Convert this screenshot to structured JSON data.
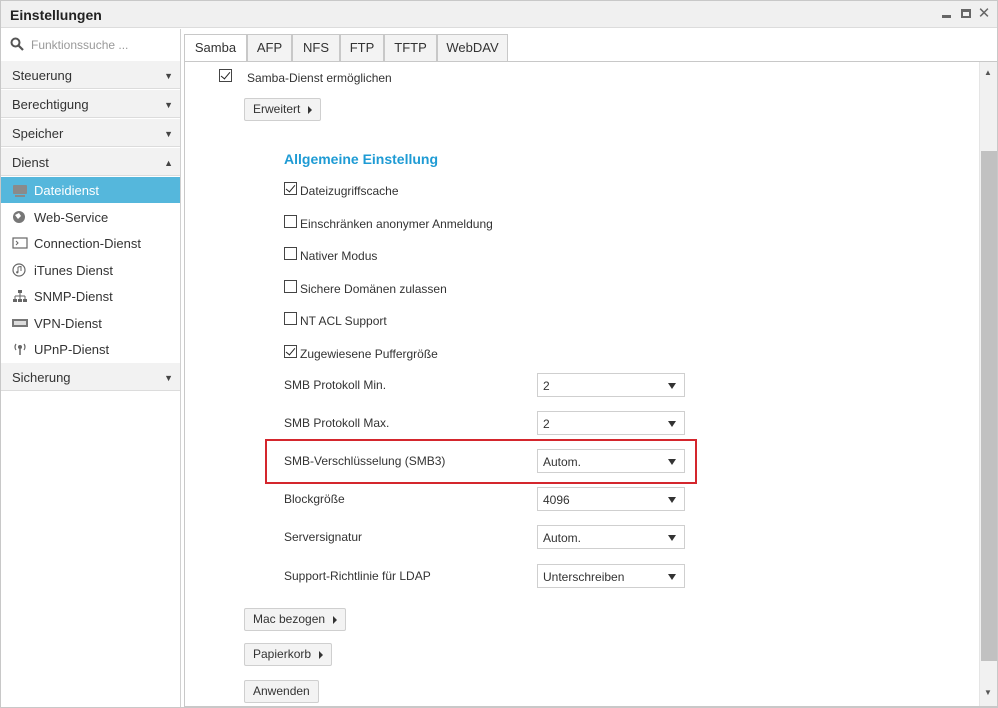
{
  "window": {
    "title": "Einstellungen",
    "controls": {
      "minimize_icon": "minimize-icon",
      "maximize_icon": "maximize-icon",
      "close_glyph": "✕"
    }
  },
  "sidebar": {
    "search_placeholder": "Funktionssuche ...",
    "categories": {
      "steuerung": "Steuerung",
      "berechtigung": "Berechtigung",
      "speicher": "Speicher",
      "dienst": "Dienst",
      "sicherung": "Sicherung"
    },
    "services": [
      {
        "label": "Dateidienst",
        "icon": "file-service-icon",
        "active": true
      },
      {
        "label": "Web-Service",
        "icon": "globe-icon"
      },
      {
        "label": "Connection-Dienst",
        "icon": "terminal-icon"
      },
      {
        "label": "iTunes Dienst",
        "icon": "music-icon"
      },
      {
        "label": "SNMP-Dienst",
        "icon": "network-icon"
      },
      {
        "label": "VPN-Dienst",
        "icon": "vpn-icon"
      },
      {
        "label": "UPnP-Dienst",
        "icon": "upnp-icon"
      }
    ]
  },
  "tabs": [
    "Samba",
    "AFP",
    "NFS",
    "FTP",
    "TFTP",
    "WebDAV"
  ],
  "samba": {
    "enable_label": "Samba-Dienst ermöglichen",
    "enable_checked": true,
    "advanced_button": "Erweitert",
    "section_title": "Allgemeine Einstellung",
    "options": [
      {
        "label": "Dateizugriffscache",
        "checked": true
      },
      {
        "label": "Einschränken anonymer Anmeldung",
        "checked": false
      },
      {
        "label": "Nativer Modus",
        "checked": false
      },
      {
        "label": "Sichere Domänen zulassen",
        "checked": false
      },
      {
        "label": "NT ACL Support",
        "checked": false
      },
      {
        "label": "Zugewiesene Puffergröße",
        "checked": true
      }
    ],
    "fields": [
      {
        "label": "SMB Protokoll Min.",
        "value": "2"
      },
      {
        "label": "SMB Protokoll Max.",
        "value": "2"
      },
      {
        "label": "SMB-Verschlüsselung (SMB3)",
        "value": "Autom."
      },
      {
        "label": "Blockgröße",
        "value": "4096"
      },
      {
        "label": "Serversignatur",
        "value": "Autom."
      },
      {
        "label": "Support-Richtlinie für LDAP",
        "value": "Unterschreiben"
      }
    ],
    "mac_button": "Mac bezogen",
    "trash_button": "Papierkorb",
    "apply_button": "Anwenden"
  },
  "colors": {
    "accent": "#1e9bd4",
    "active_item": "#55b7dc",
    "highlight_box": "#d4262d"
  }
}
